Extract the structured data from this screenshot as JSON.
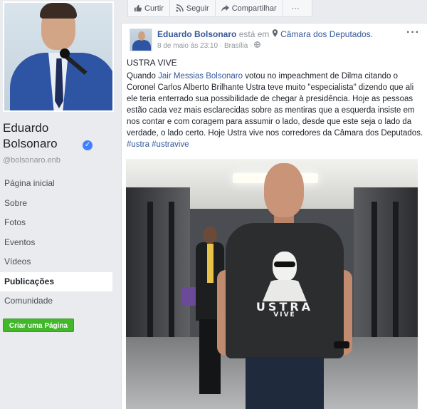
{
  "profile": {
    "name": "Eduardo Bolsonaro",
    "verified_badge": "✓",
    "handle": "@bolsonaro.enb"
  },
  "nav": {
    "items": [
      {
        "label": "Página inicial"
      },
      {
        "label": "Sobre"
      },
      {
        "label": "Fotos"
      },
      {
        "label": "Eventos"
      },
      {
        "label": "Vídeos"
      },
      {
        "label": "Publicações",
        "active": true
      },
      {
        "label": "Comunidade"
      }
    ],
    "create_page": "Criar uma Página"
  },
  "actionbar": {
    "like": "Curtir",
    "follow": "Seguir",
    "share": "Compartilhar",
    "more": "···"
  },
  "post": {
    "author": "Eduardo Bolsonaro",
    "is_at": "está em",
    "place": "Câmara dos Deputados.",
    "date": "8 de maio às 23:10",
    "city": "Brasília",
    "more": "···",
    "title": "USTRA VIVE",
    "body_pre": "Quando ",
    "body_link": "Jair Messias Bolsonaro",
    "body_post": " votou no impeachment de Dilma citando o Coronel Carlos Alberto Brilhante Ustra teve muito \"especialista\" dizendo que ali ele teria enterrado sua possibilidade de chegar à presidência. Hoje as pessoas estão cada vez mais esclarecidas sobre as mentiras que a esquerda insiste em nos contar e com coragem para assumir o lado, desde que este seja o lado da verdade, o lado certo. Hoje Ustra vive nos corredores da Câmara dos Deputados. ",
    "hashtags": "#ustra #ustravive",
    "shirt_text": "USTRA",
    "shirt_subtext": "VIVE"
  },
  "icons": {
    "like": "thumbs-up-icon",
    "follow": "rss-icon",
    "share": "share-arrow-icon",
    "verified": "verified-check-icon",
    "globe": "globe-icon",
    "location": "location-pin-icon"
  },
  "colors": {
    "link": "#365899",
    "create_button": "#42b72a",
    "verified": "#4080ff"
  }
}
